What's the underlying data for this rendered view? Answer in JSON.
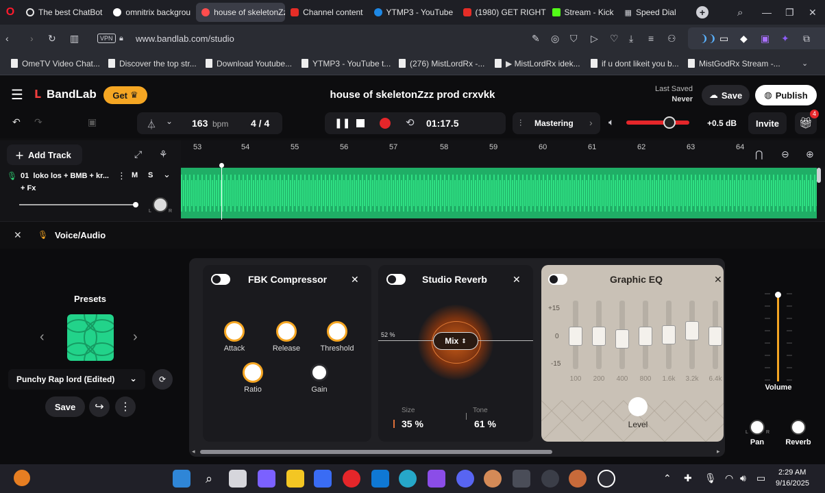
{
  "browser": {
    "tabs": [
      {
        "title": "The best ChatBot",
        "color": "#e33b2e"
      },
      {
        "title": "omnitrix backgrou",
        "color": "#ffffff"
      },
      {
        "title": "house of skeletonZzz",
        "color": "#ff4d4d",
        "active": true
      },
      {
        "title": "Channel content",
        "color": "#e52d27"
      },
      {
        "title": "YTMP3 - YouTube",
        "color": "#1e88e5"
      },
      {
        "title": "(1980) GET RIGHT",
        "color": "#e52d27"
      },
      {
        "title": "Stream - Kick",
        "color": "#53fc18"
      },
      {
        "title": "Speed Dial",
        "color": "#cccccc"
      }
    ],
    "url": "www.bandlab.com/studio",
    "vpn_label": "VPN",
    "bookmarks": [
      "OmeTV Video Chat...",
      "Discover the top str...",
      "Download Youtube...",
      "YTMP3 - YouTube t...",
      "(276) MistLordRx -...",
      "▶ MistLordRx idek...",
      "if u dont likeit you b...",
      "MistGodRx Stream -..."
    ]
  },
  "app": {
    "brand": "BandLab",
    "get_label": "Get",
    "project_title": "house of skeletonZzz prod crxvkk",
    "last_saved_label": "Last Saved",
    "last_saved_value": "Never",
    "save_label": "Save",
    "publish_label": "Publish",
    "bpm_value": "163",
    "bpm_unit": "bpm",
    "time_signature": "4 / 4",
    "time_display": "01:17.5",
    "mastering_label": "Mastering",
    "volume_db": "+0.5 dB",
    "invite_label": "Invite",
    "gift_badge": "4",
    "add_track_label": "Add Track",
    "ruler": [
      "53",
      "54",
      "55",
      "56",
      "57",
      "58",
      "59",
      "60",
      "61",
      "62",
      "63",
      "64"
    ],
    "track": {
      "name": "01  loko los + BMB + kr...",
      "mute": "M",
      "solo": "S",
      "fx": "+ Fx",
      "pan_l": "L",
      "pan_r": "R"
    },
    "voice_audio_label": "Voice/Audio",
    "presets": {
      "title": "Presets",
      "current": "Punchy Rap lord (Edited)",
      "save_label": "Save"
    },
    "compressor": {
      "title": "FBK Compressor",
      "knobs": [
        "Attack",
        "Release",
        "Threshold",
        "Ratio",
        "Gain"
      ]
    },
    "reverb": {
      "title": "Studio Reverb",
      "mix_pct": "52 %",
      "mix_label": "Mix",
      "size_label": "Size",
      "size_value": "35 %",
      "tone_label": "Tone",
      "tone_value": "61 %"
    },
    "eq": {
      "title": "Graphic EQ",
      "scale": [
        "+15",
        "0",
        "-15"
      ],
      "bands": [
        "100",
        "200",
        "400",
        "800",
        "1.6k",
        "3.2k",
        "6.4k"
      ],
      "level_label": "Level"
    },
    "master": {
      "volume_label": "Volume",
      "pan_label": "Pan",
      "reverb_label": "Reverb",
      "pan_l": "L",
      "pan_r": "R"
    }
  },
  "taskbar": {
    "time": "2:29 AM",
    "date": "9/16/2025"
  }
}
